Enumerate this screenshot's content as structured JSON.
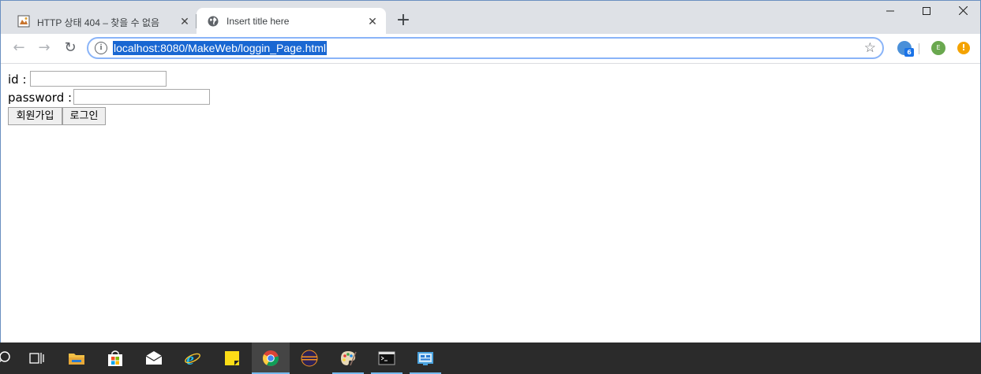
{
  "browser": {
    "tabs": [
      {
        "title": "HTTP 상태 404 – 찾을 수 없음",
        "active": false,
        "icon": "tomcat-favicon"
      },
      {
        "title": "Insert title here",
        "active": true,
        "icon": "globe-icon"
      }
    ],
    "close_glyph": "✕",
    "new_tab_glyph": "+",
    "window_controls": {
      "minimize": "—",
      "maximize": "☐",
      "close": "✕"
    },
    "address": {
      "url": "localhost:8080/MakeWeb/loggin_Page.html",
      "info_glyph": "i",
      "star_glyph": "☆"
    },
    "nav": {
      "back": "←",
      "forward": "→",
      "reload": "↻"
    },
    "extensions": [
      {
        "name": "extension-globe-icon",
        "badge": "6"
      },
      {
        "name": "extension-green-icon",
        "label": "E"
      },
      {
        "name": "extension-warning-icon",
        "label": "!"
      }
    ],
    "accent_color": "#1967d2"
  },
  "page": {
    "id_label": "id :",
    "id_value": "",
    "password_label": "password :",
    "password_value": "",
    "join_button": "회원가입",
    "login_button": "로그인"
  },
  "taskbar": {
    "items": [
      "search",
      "task-view",
      "file-explorer",
      "store",
      "mail",
      "edge",
      "sticky-notes",
      "chrome",
      "eclipse",
      "paint",
      "terminal",
      "control-panel"
    ],
    "active": "chrome"
  }
}
